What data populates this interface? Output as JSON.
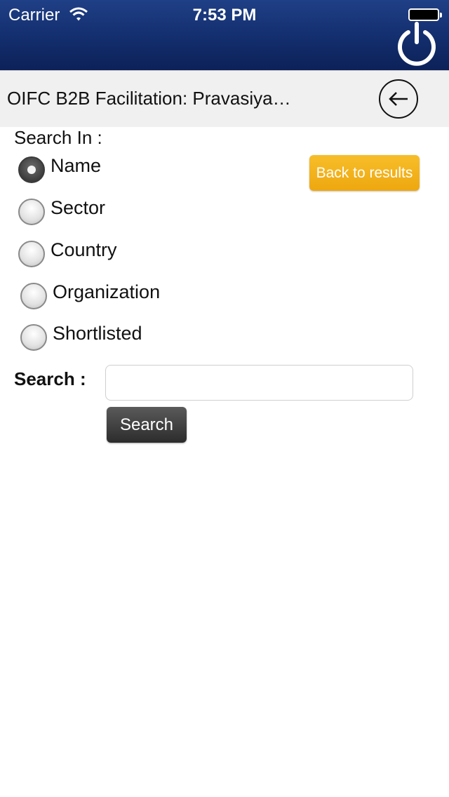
{
  "status_bar": {
    "carrier": "Carrier",
    "time": "7:53 PM"
  },
  "header": {
    "title": "OIFC B2B Facilitation: Pravasiya…",
    "icons": {
      "power": "power-icon",
      "back": "back-arrow-icon"
    }
  },
  "search_in": {
    "label": "Search In :",
    "selected": "Name",
    "options": [
      {
        "label": "Name",
        "checked": true
      },
      {
        "label": "Sector",
        "checked": false
      },
      {
        "label": "Country",
        "checked": false
      },
      {
        "label": "Organization",
        "checked": false
      },
      {
        "label": "Shortlisted",
        "checked": false
      }
    ]
  },
  "back_to_results_label": "Back to results",
  "search": {
    "label": "Search :",
    "value": "",
    "button_label": "Search"
  },
  "colors": {
    "header_bg": "#153172",
    "title_bar_bg": "#f0f0f0",
    "accent_button": "#f2ad16",
    "dark_button": "#3a3a3a"
  }
}
